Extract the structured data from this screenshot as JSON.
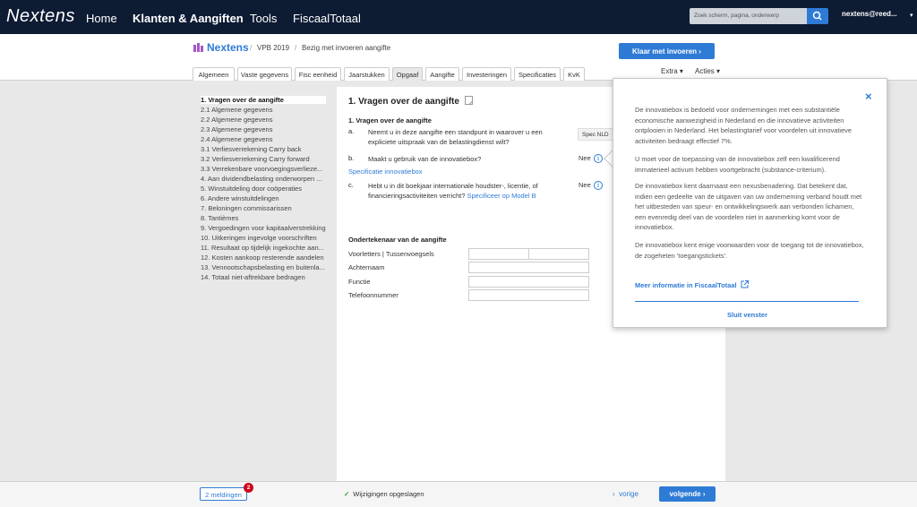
{
  "topbar": {
    "logo": "Nextens",
    "nav": [
      "Home",
      "Klanten & Aangiften",
      "Tools",
      "FiscaalTotaal"
    ],
    "search_placeholder": "Zoek scherm, pagina, onderwerp",
    "user": "nextens@reed...",
    "caret": "▾"
  },
  "breadcrumb": {
    "company": "Nextens",
    "sep": "/",
    "items": [
      "VPB 2019",
      "Bezig met invoeren aangifte"
    ]
  },
  "actions": {
    "klaar": "Klaar met invoeren",
    "extra": "Extra",
    "acties": "Acties",
    "caret": "▾",
    "chevron": "›"
  },
  "tabs": [
    "Algemeen",
    "Vaste gegevens",
    "Fisc eenheid",
    "Jaarstukken",
    "Opgaaf",
    "Aangifte",
    "Investeringen",
    "Specificaties",
    "KvK"
  ],
  "sidebar": [
    "1. Vragen over de aangifte",
    "2.1 Algemene gegevens",
    "2.2 Algemene gegevens",
    "2.3 Algemene gegevens",
    "2.4 Algemene gegevens",
    "3.1 Verliesverrekening Carry back",
    "3.2 Verliesverrekening Carry forward",
    "3.3 Verrekenbare voorvoegingsverlieze...",
    "4. Aan dividendbelasting onderworpen ...",
    "5. Winstuitdeling door coöperaties",
    "6. Andere winstuitdelingen",
    "7. Beloningen commissarissen",
    "8. Tantièmes",
    "9. Vergoedingen voor kapitaalverstrekking",
    "10. Uitkeringen ingevolge voorschriften",
    "11. Resultaat op tijdelijk ingekochte aan...",
    "12. Kosten aankoop resterende aandelen",
    "13. Vennootschapsbelasting en buitenla...",
    "14. Totaal niet-aftrekbare bedragen"
  ],
  "main": {
    "title": "1. Vragen over de aangifte",
    "subtitle": "1. Vragen over de aangifte",
    "questions": [
      {
        "letter": "a.",
        "text": "Neemt u in deze aangifte een standpunt in waarover u een expliciete uitspraak van de belastingdienst wilt?",
        "spec": "Spec NLD"
      },
      {
        "letter": "b.",
        "text": "Maakt u gebruik van de innovatiebox?",
        "answer": "Nee",
        "info": "i"
      },
      {
        "letter": "c.",
        "text": "Hebt u in dit boekjaar internationale houdster-, licentie, of financieringsactiviteiten verricht?",
        "link": "Specificeer op Model B",
        "answer": "Nee",
        "info": "i"
      }
    ],
    "spec_link": "Specificatie innovatiebox",
    "signer_title": "Ondertekenaar van de aangifte",
    "signer_fields": [
      "Voorletters | Tussenvoegsels",
      "Achternaam",
      "Functie",
      "Telefoonnummer"
    ]
  },
  "popup": {
    "close": "×",
    "paragraphs": [
      "De innovatiebox is bedoeld voor ondernemingen met een substantiële economische aanwezigheid in Nederland en die innovatieve activiteiten ontplooien in Nederland. Het belastingtarief voor voordelen uit innovatieve activiteiten bedraagt effectief 7%.",
      "U moet voor de toepassing van de innovatiebox zelf een kwalificerend immaterieel activum hebben voortgebracht (substance-criterium).",
      "De innovatiebox kent daarnaast een nexusbenadering. Dat betekent dat, indien een gedeelte van de uitgaven van uw onderneming verband houdt met het uitbesteden van speur- en ontwikkelingswerk aan verbonden lichamen, een evenredig deel van de voordelen niet in aanmerking komt voor de innovatiebox.",
      "De innovatiebox kent enige voorwaarden voor de toegang tot de innovatiebox, de zogeheten 'toegangstickets'."
    ],
    "more_link": "Meer informatie in FiscaalTotaal",
    "close_button": "Sluit venster"
  },
  "footer": {
    "meldingen": "2 meldingen",
    "badge": "2",
    "saved": "Wijzigingen opgeslagen",
    "check": "✓",
    "vorige": "vorige",
    "volgende": "volgende",
    "prev_chevron": "‹",
    "next_chevron": "›"
  }
}
